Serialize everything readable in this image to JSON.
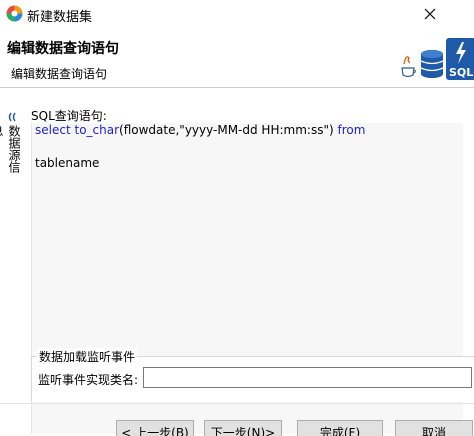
{
  "window": {
    "title": "新建数据集",
    "close_icon": "close-icon",
    "app_icon": "app-logo-icon"
  },
  "header": {
    "title": "编辑数据查询语句",
    "subtitle": "编辑数据查询语句",
    "art_label": "SQL"
  },
  "side_tab": {
    "label": "数据源信息",
    "icon": "collapse-arrows-icon"
  },
  "editor": {
    "label": "SQL查询语句:",
    "line1": {
      "kw_select": "select",
      "fn": "to_char",
      "args": "(flowdate,\"yyyy-MM-dd HH:mm:ss\")",
      "kw_from": "from"
    },
    "line2": "tablename"
  },
  "listener": {
    "group_title": "数据加载监听事件",
    "label": "监听事件实现类名:",
    "value": ""
  },
  "buttons": {
    "prev": "< 上一步(B)",
    "next": "下一步(N)>",
    "finish": "完成(F)",
    "cancel": "取消"
  },
  "colors": {
    "keyword": "#1f1fd0",
    "editor_bg": "#f7f7f7",
    "button_bg": "#e1e1e1"
  }
}
